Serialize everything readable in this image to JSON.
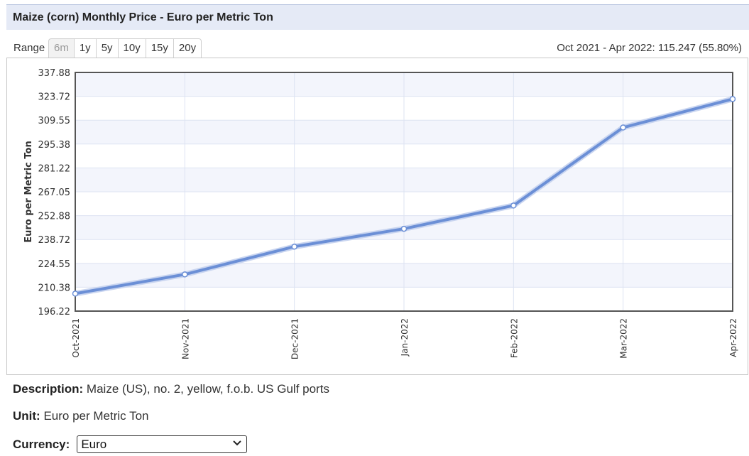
{
  "header": {
    "title": "Maize (corn) Monthly Price - Euro per Metric Ton"
  },
  "range": {
    "label": "Range",
    "buttons": [
      "6m",
      "1y",
      "5y",
      "10y",
      "15y",
      "20y"
    ],
    "active": "6m",
    "summary": "Oct 2021 - Apr 2022: 115.247 (55.80%)"
  },
  "chart_data": {
    "type": "line",
    "ylabel": "Euro per Metric Ton",
    "ylim": [
      196.22,
      337.88
    ],
    "yticks": [
      "337.88",
      "323.72",
      "309.55",
      "295.38",
      "281.22",
      "267.05",
      "252.88",
      "238.72",
      "224.55",
      "210.38",
      "196.22"
    ],
    "categories": [
      "Oct-2021",
      "Nov-2021",
      "Dec-2021",
      "Jan-2022",
      "Feb-2022",
      "Mar-2022",
      "Apr-2022"
    ],
    "values": [
      206.6,
      218.0,
      234.5,
      245.1,
      258.9,
      305.2,
      322.1
    ],
    "line_color": "#6b8fd6",
    "band_color": "#f3f5fc",
    "grid": true
  },
  "info": {
    "description_label": "Description:",
    "description_value": "Maize (US), no. 2, yellow, f.o.b. US Gulf ports",
    "unit_label": "Unit:",
    "unit_value": "Euro per Metric Ton",
    "currency_label": "Currency:",
    "currency_value": "Euro"
  }
}
